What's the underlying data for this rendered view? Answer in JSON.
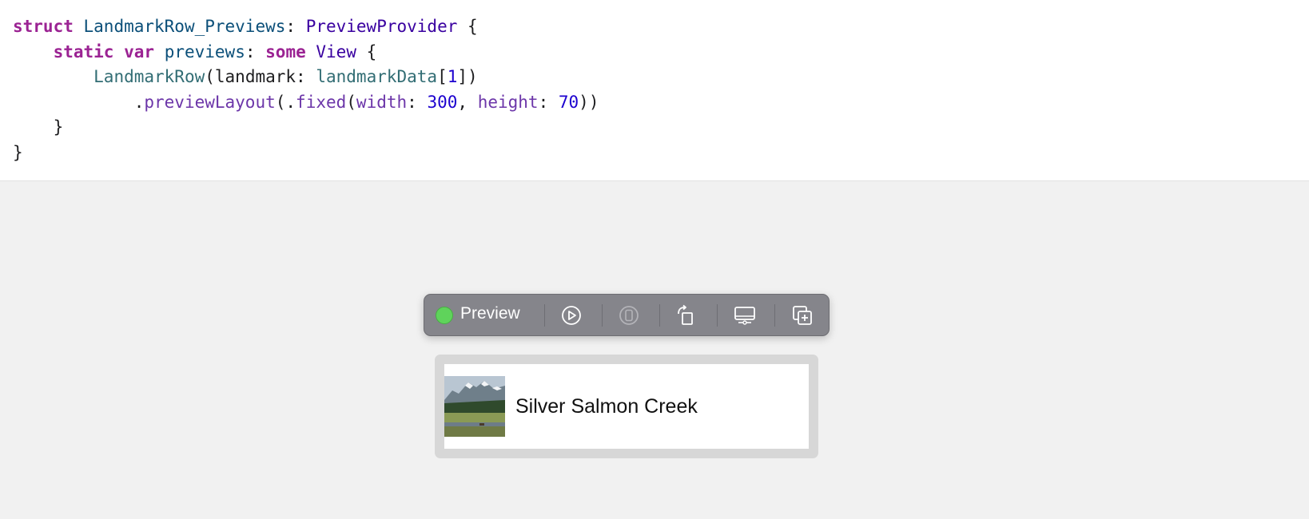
{
  "code": {
    "line1": {
      "kw_struct": "struct",
      "type_name": "LandmarkRow_Previews",
      "colon": ":",
      "protocol": "PreviewProvider",
      "brace": "{"
    },
    "line2": {
      "kw_static": "static",
      "kw_var": "var",
      "prop": "previews",
      "colon": ":",
      "kw_some": "some",
      "type_view": "View",
      "brace": "{"
    },
    "line3": {
      "call": "LandmarkRow",
      "open": "(",
      "arg_label": "landmark",
      "colon": ":",
      "data_ident": "landmarkData",
      "lbracket": "[",
      "index": "1",
      "rbracket_paren": "])"
    },
    "line4": {
      "dot": ".",
      "modifier": "previewLayout",
      "open_dot": "(.",
      "fixed": "fixed",
      "open": "(",
      "width_label": "width",
      "colon1": ":",
      "width_val": "300",
      "comma": ",",
      "height_label": "height",
      "colon2": ":",
      "height_val": "70",
      "close": "))"
    },
    "line5": "}",
    "line6": "}"
  },
  "toolbar": {
    "preview_label": "Preview",
    "status_color": "#5fd35b",
    "buttons": [
      {
        "icon": "play-circle-icon"
      },
      {
        "icon": "device-icon"
      },
      {
        "icon": "rotate-device-icon"
      },
      {
        "icon": "display-settings-icon"
      },
      {
        "icon": "duplicate-preview-icon"
      }
    ]
  },
  "preview": {
    "row_title": "Silver Salmon Creek",
    "thumbnail": "landmark-thumbnail"
  }
}
